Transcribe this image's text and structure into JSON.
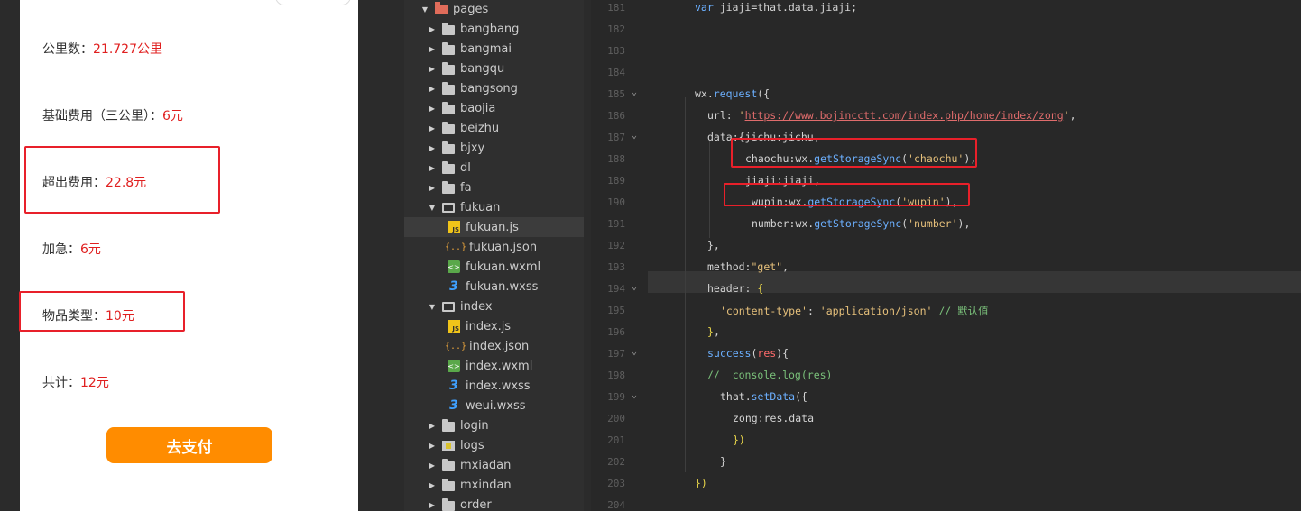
{
  "simulator": {
    "rows": [
      {
        "label": "公里数：",
        "value": "21.727公里"
      },
      {
        "label": "基础费用（三公里）：",
        "value": "6元"
      },
      {
        "label": "超出费用：",
        "value": "22.8元"
      },
      {
        "label": "加急：",
        "value": "6元"
      },
      {
        "label": "物品类型：",
        "value": "10元"
      },
      {
        "label": "共计：",
        "value": "12元"
      }
    ],
    "pay_button": "去支付",
    "back_icon": "chevron-left-icon"
  },
  "file_tree": [
    {
      "label": "pages",
      "type": "folder-pages",
      "open": true,
      "depth": 0
    },
    {
      "label": "bangbang",
      "type": "folder",
      "open": false,
      "depth": 1
    },
    {
      "label": "bangmai",
      "type": "folder",
      "open": false,
      "depth": 1
    },
    {
      "label": "bangqu",
      "type": "folder",
      "open": false,
      "depth": 1
    },
    {
      "label": "bangsong",
      "type": "folder",
      "open": false,
      "depth": 1
    },
    {
      "label": "baojia",
      "type": "folder",
      "open": false,
      "depth": 1
    },
    {
      "label": "beizhu",
      "type": "folder",
      "open": false,
      "depth": 1
    },
    {
      "label": "bjxy",
      "type": "folder",
      "open": false,
      "depth": 1
    },
    {
      "label": "dl",
      "type": "folder",
      "open": false,
      "depth": 1
    },
    {
      "label": "fa",
      "type": "folder",
      "open": false,
      "depth": 1
    },
    {
      "label": "fukuan",
      "type": "folder",
      "open": true,
      "depth": 1
    },
    {
      "label": "fukuan.js",
      "type": "js",
      "depth": 2,
      "selected": true
    },
    {
      "label": "fukuan.json",
      "type": "json",
      "depth": 2
    },
    {
      "label": "fukuan.wxml",
      "type": "wxml",
      "depth": 2
    },
    {
      "label": "fukuan.wxss",
      "type": "wxss",
      "depth": 2
    },
    {
      "label": "index",
      "type": "folder",
      "open": true,
      "depth": 1
    },
    {
      "label": "index.js",
      "type": "js",
      "depth": 2
    },
    {
      "label": "index.json",
      "type": "json",
      "depth": 2
    },
    {
      "label": "index.wxml",
      "type": "wxml",
      "depth": 2
    },
    {
      "label": "index.wxss",
      "type": "wxss",
      "depth": 2
    },
    {
      "label": "weui.wxss",
      "type": "wxss",
      "depth": 2
    },
    {
      "label": "login",
      "type": "folder",
      "open": false,
      "depth": 1
    },
    {
      "label": "logs",
      "type": "folder-logs",
      "open": false,
      "depth": 1
    },
    {
      "label": "mxiadan",
      "type": "folder",
      "open": false,
      "depth": 1
    },
    {
      "label": "mxindan",
      "type": "folder",
      "open": false,
      "depth": 1
    },
    {
      "label": "order",
      "type": "folder",
      "open": false,
      "depth": 1
    }
  ],
  "editor": {
    "lines": [
      {
        "n": "181",
        "fold": false,
        "indent": 4,
        "tokens": [
          [
            "kw",
            "var "
          ],
          [
            "plain",
            "jiaji=that.data.jiaji;"
          ]
        ]
      },
      {
        "n": "182",
        "fold": false,
        "indent": 0,
        "tokens": []
      },
      {
        "n": "183",
        "fold": false,
        "indent": 0,
        "tokens": []
      },
      {
        "n": "184",
        "fold": false,
        "indent": 0,
        "tokens": []
      },
      {
        "n": "185",
        "fold": true,
        "indent": 4,
        "tokens": [
          [
            "plain",
            "wx."
          ],
          [
            "fn",
            "request"
          ],
          [
            "plain",
            "({"
          ]
        ]
      },
      {
        "n": "186",
        "fold": false,
        "indent": 6,
        "tokens": [
          [
            "plain",
            "url: "
          ],
          [
            "str",
            "'"
          ],
          [
            "url",
            "https://www.bojincctt.com/index.php/home/index/zong"
          ],
          [
            "str",
            "'"
          ],
          [
            "plain",
            ","
          ]
        ]
      },
      {
        "n": "187",
        "fold": true,
        "indent": 6,
        "tokens": [
          [
            "plain",
            "data:{jichu:jichu,"
          ]
        ]
      },
      {
        "n": "188",
        "fold": false,
        "indent": 12,
        "tokens": [
          [
            "plain",
            "chaochu:wx."
          ],
          [
            "fn",
            "getStorageSync"
          ],
          [
            "plain",
            "("
          ],
          [
            "str",
            "'chaochu'"
          ],
          [
            "plain",
            "),"
          ]
        ]
      },
      {
        "n": "189",
        "fold": false,
        "indent": 12,
        "tokens": [
          [
            "plain",
            "jiaji:jiaji,"
          ]
        ]
      },
      {
        "n": "190",
        "fold": false,
        "indent": 13,
        "tokens": [
          [
            "plain",
            "wupin:wx."
          ],
          [
            "fn",
            "getStorageSync"
          ],
          [
            "plain",
            "("
          ],
          [
            "str",
            "'wupin'"
          ],
          [
            "plain",
            "),"
          ]
        ]
      },
      {
        "n": "191",
        "fold": false,
        "indent": 13,
        "tokens": [
          [
            "plain",
            "number:wx."
          ],
          [
            "fn",
            "getStorageSync"
          ],
          [
            "plain",
            "("
          ],
          [
            "str",
            "'number'"
          ],
          [
            "plain",
            "),"
          ]
        ]
      },
      {
        "n": "192",
        "fold": false,
        "indent": 6,
        "tokens": [
          [
            "plain",
            "},"
          ]
        ]
      },
      {
        "n": "193",
        "fold": false,
        "indent": 6,
        "tokens": [
          [
            "plain",
            "method:"
          ],
          [
            "str",
            "\"get\""
          ],
          [
            "plain",
            ","
          ]
        ]
      },
      {
        "n": "194",
        "fold": true,
        "indent": 6,
        "tokens": [
          [
            "plain",
            "header: "
          ],
          [
            "yel",
            "{"
          ]
        ]
      },
      {
        "n": "195",
        "fold": false,
        "indent": 8,
        "tokens": [
          [
            "str",
            "'content-type'"
          ],
          [
            "plain",
            ": "
          ],
          [
            "str",
            "'application/json'"
          ],
          [
            "com",
            " // 默认值"
          ]
        ]
      },
      {
        "n": "196",
        "fold": false,
        "indent": 6,
        "tokens": [
          [
            "yel",
            "}"
          ],
          [
            "plain",
            ","
          ]
        ]
      },
      {
        "n": "197",
        "fold": true,
        "indent": 6,
        "tokens": [
          [
            "fn",
            "success"
          ],
          [
            "plain",
            "("
          ],
          [
            "red",
            "res"
          ],
          [
            "plain",
            "){"
          ]
        ]
      },
      {
        "n": "198",
        "fold": false,
        "indent": 6,
        "tokens": [
          [
            "com",
            "//  console.log(res)"
          ]
        ]
      },
      {
        "n": "199",
        "fold": true,
        "indent": 8,
        "tokens": [
          [
            "plain",
            "that."
          ],
          [
            "fn",
            "setData"
          ],
          [
            "plain",
            "({"
          ]
        ]
      },
      {
        "n": "200",
        "fold": false,
        "indent": 10,
        "tokens": [
          [
            "plain",
            "zong:res.data"
          ]
        ]
      },
      {
        "n": "201",
        "fold": false,
        "indent": 10,
        "tokens": [
          [
            "yel",
            "})"
          ]
        ]
      },
      {
        "n": "202",
        "fold": false,
        "indent": 8,
        "tokens": [
          [
            "plain",
            "}"
          ]
        ]
      },
      {
        "n": "203",
        "fold": false,
        "indent": 4,
        "tokens": [
          [
            "yel",
            "})"
          ]
        ]
      },
      {
        "n": "204",
        "fold": false,
        "indent": 0,
        "tokens": []
      }
    ]
  },
  "colors": {
    "highlight_box": "#e8202a",
    "pay_button_bg": "#ff8c00",
    "value_text": "#e02020"
  }
}
